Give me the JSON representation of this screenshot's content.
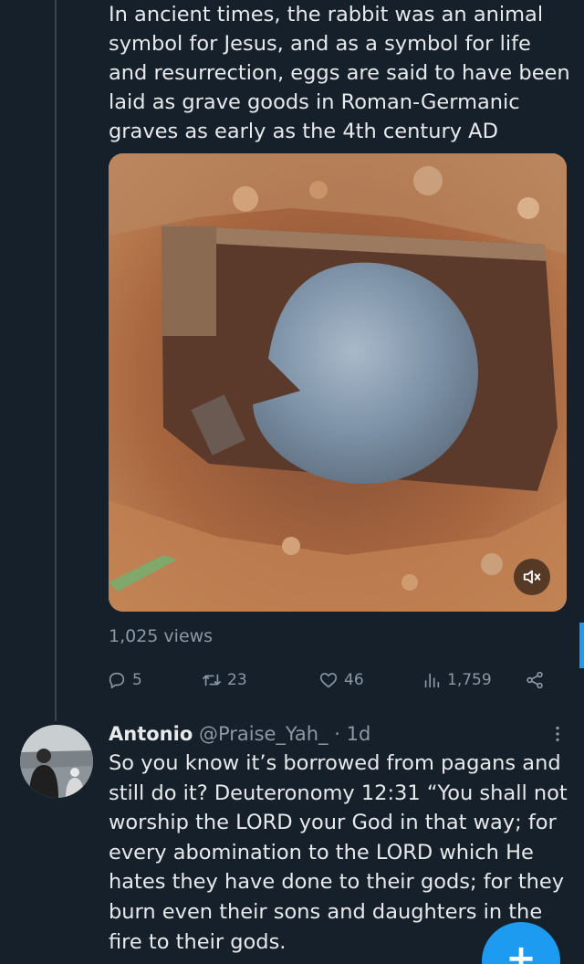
{
  "tweet": {
    "text": "In ancient times, the rabbit was an animal symbol for Jesus, and as a symbol for life and resurrection, eggs are said to have been laid as grave goods in Roman-Germanic graves as early as the 4th century AD",
    "views_text": "1,025 views",
    "actions": {
      "replies": "5",
      "retweets": "23",
      "likes": "46",
      "views": "1,759"
    },
    "media_icon": "volume-muted-icon"
  },
  "reply": {
    "name": "Antonio",
    "handle": "@Praise_Yah_",
    "time": "· 1d",
    "text": "So you know it’s borrowed from pagans and still do it? Deuteronomy 12:31 “You shall not worship the LORD your God in that way; for every abomination to the LORD which He hates they have done to their gods; for they burn even their sons and daughters in the fire to their gods."
  },
  "fab": {
    "icon": "plus-icon",
    "label": "+"
  },
  "colors": {
    "background": "#15202b",
    "text": "#e7e9ea",
    "muted": "#8b98a5",
    "accent": "#1d9bf0"
  }
}
